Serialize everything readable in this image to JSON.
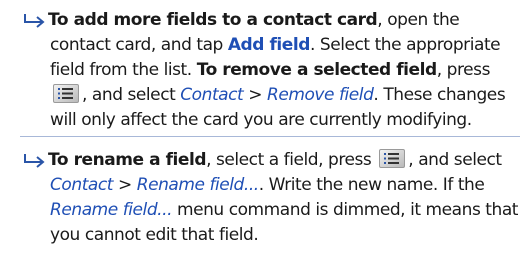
{
  "tip1": {
    "l1_bold": "To add more fields to a contact card",
    "l1_rest": ", open the",
    "l2_a": "contact card, and tap ",
    "l2_link": "Add field",
    "l2_b": ". Select the appropriate",
    "l3_a": "field from the list. ",
    "l3_bold": "To remove a selected field",
    "l3_b": ", press",
    "l4_b": ", and select ",
    "l4_menu1": "Contact",
    "l4_sep": " > ",
    "l4_menu2": "Remove field",
    "l4_c": ". These changes",
    "l5": "will only affect the card you are currently modifying."
  },
  "tip2": {
    "l1_bold": "To rename a field",
    "l1_a": ", select a field, press ",
    "l1_b": ", and select",
    "l2_menu1": "Contact",
    "l2_sep": " > ",
    "l2_menu2": "Rename field...",
    "l2_b": ". Write the new name. If the",
    "l3_menu": "Rename field...",
    "l3_b": " menu command is dimmed, it means that",
    "l4": "you cannot edit that field."
  },
  "icons": {
    "tip_arrow": "return-arrow-icon",
    "menu_key": "menu-key-icon"
  },
  "colors": {
    "link": "#1f4fb5",
    "arrow": "#2a55a8"
  }
}
